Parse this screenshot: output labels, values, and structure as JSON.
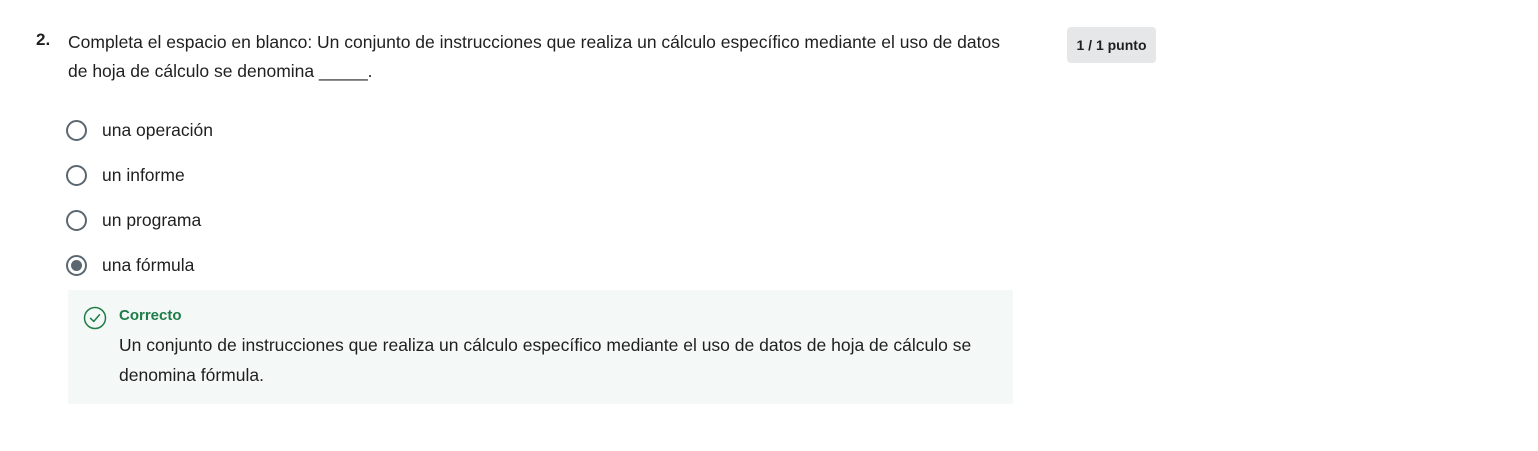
{
  "question": {
    "number": "2.",
    "text": "Completa el espacio en blanco: Un conjunto de instrucciones que realiza un cálculo específico mediante el uso de datos de hoja de cálculo se denomina _____."
  },
  "score": {
    "label": "1 / 1 punto"
  },
  "options": [
    {
      "label": "una operación",
      "selected": false
    },
    {
      "label": "un informe",
      "selected": false
    },
    {
      "label": "un programa",
      "selected": false
    },
    {
      "label": "una fórmula",
      "selected": true
    }
  ],
  "feedback": {
    "status": "Correcto",
    "icon": "check-circle-icon",
    "text": "Un conjunto de instrucciones que realiza un cálculo específico mediante el uso de datos de hoja de cálculo se denomina fórmula.",
    "accent_color": "#1e7d48",
    "background_color": "#f4f8f6"
  }
}
